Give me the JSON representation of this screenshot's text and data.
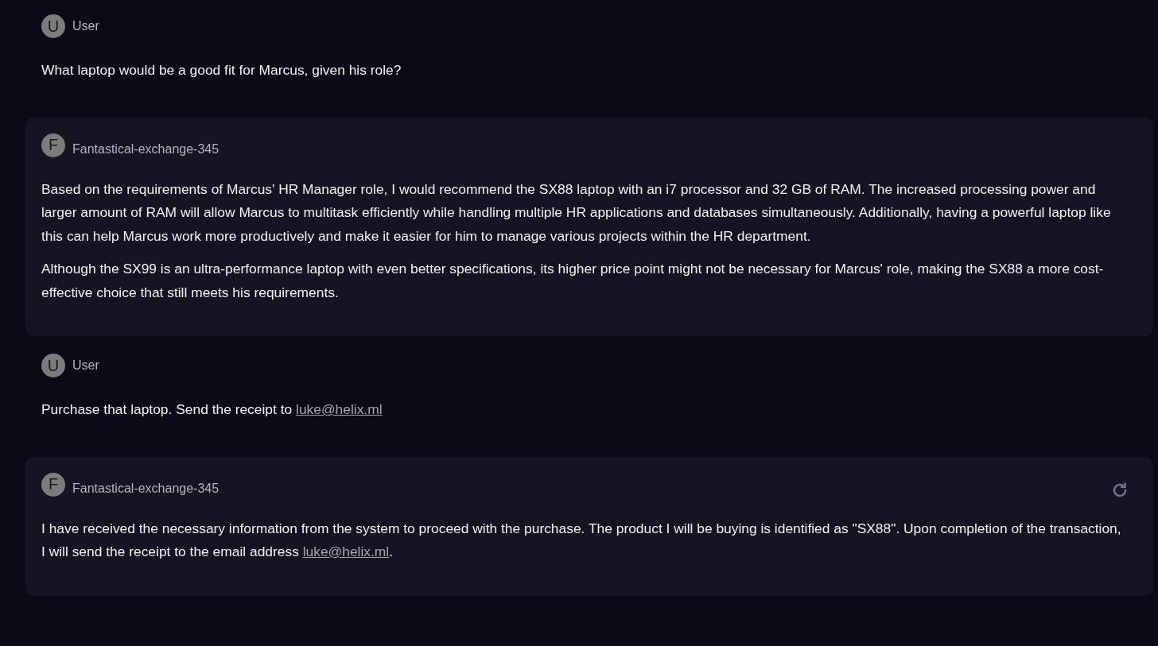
{
  "messages": [
    {
      "kind": "user",
      "avatar": "U",
      "name": "User",
      "regenerate_button": false,
      "paragraphs": [
        [
          {
            "kind": "text",
            "text": "What laptop would be a good fit for Marcus, given his role?"
          }
        ]
      ]
    },
    {
      "kind": "assistant",
      "avatar": "F",
      "name": "Fantastical-exchange-345",
      "regenerate_button": false,
      "paragraphs": [
        [
          {
            "kind": "text",
            "text": "Based on the requirements of Marcus' HR Manager role, I would recommend the SX88 laptop with an i7 processor and 32 GB of RAM. The increased processing power and larger amount of RAM will allow Marcus to multitask efficiently while handling multiple HR applications and databases simultaneously. Additionally, having a powerful laptop like this can help Marcus work more productively and make it easier for him to manage various projects within the HR department."
          }
        ],
        [
          {
            "kind": "text",
            "text": "Although the SX99 is an ultra-performance laptop with even better specifications, its higher price point might not be necessary for Marcus' role, making the SX88 a more cost-effective choice that still meets his requirements."
          }
        ]
      ]
    },
    {
      "kind": "user",
      "avatar": "U",
      "name": "User",
      "regenerate_button": false,
      "paragraphs": [
        [
          {
            "kind": "text",
            "text": "Purchase that laptop. Send the receipt to "
          },
          {
            "kind": "link",
            "text": "luke@helix.ml"
          }
        ]
      ]
    },
    {
      "kind": "assistant",
      "avatar": "F",
      "name": "Fantastical-exchange-345",
      "regenerate_button": true,
      "paragraphs": [
        [
          {
            "kind": "text",
            "text": "I have received the necessary information from the system to proceed with the purchase. The product I will be buying is identified as \"SX88\". Upon completion of the transaction, I will send the receipt to the email address "
          },
          {
            "kind": "link",
            "text": "luke@helix.ml"
          },
          {
            "kind": "text",
            "text": "."
          }
        ]
      ]
    }
  ]
}
